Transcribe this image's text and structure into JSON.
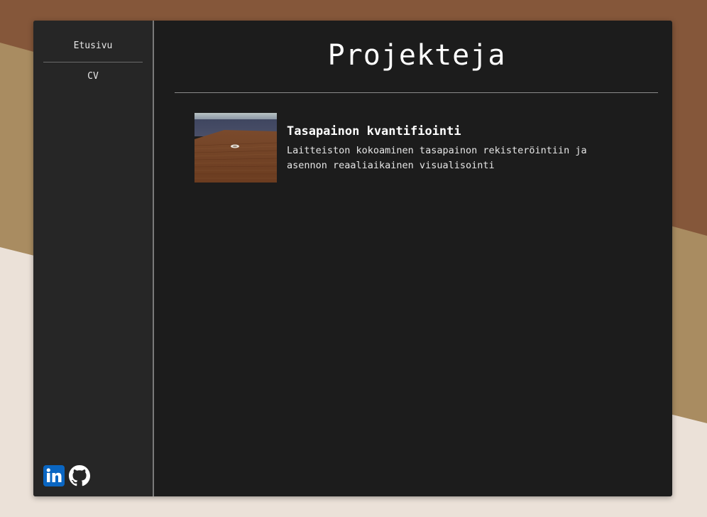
{
  "background": {
    "colors": [
      "#85573a",
      "#a98c61",
      "#ebe1d8"
    ]
  },
  "sidebar": {
    "nav": [
      {
        "label": "Etusivu"
      },
      {
        "label": "CV"
      }
    ],
    "social": [
      {
        "icon": "linkedin-icon",
        "color": "#0a66c2"
      },
      {
        "icon": "github-icon",
        "color": "#ffffff"
      }
    ]
  },
  "main": {
    "title": "Projekteja",
    "projects": [
      {
        "title": "Tasapainon kvantifiointi",
        "description": "Laitteiston kokoaminen tasapainon rekisteröintiin ja asennon reaaliaikainen visualisointi",
        "thumbnail": "wooden-floor-render"
      }
    ]
  }
}
